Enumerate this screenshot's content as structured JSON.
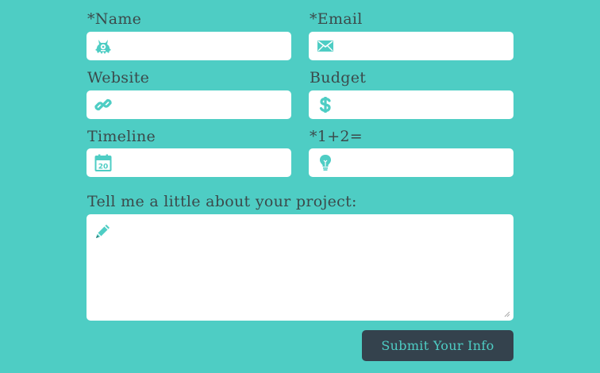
{
  "form": {
    "name_label": "*Name",
    "email_label": "*Email",
    "website_label": "Website",
    "budget_label": "Budget",
    "timeline_label": "Timeline",
    "captcha_label": "*1+2=",
    "project_label": "Tell me a little about your project:",
    "submit_label": "Submit Your Info",
    "icons": {
      "name": "monster-icon",
      "email": "envelope-icon",
      "website": "link-icon",
      "budget": "dollar-icon",
      "timeline": "calendar-icon",
      "captcha": "lightbulb-icon",
      "project": "pencil-icon"
    },
    "calendar_day": "20"
  },
  "colors": {
    "background": "#4ecdc4",
    "field": "#ffffff",
    "icon": "#4ecdc4",
    "label_text": "#3b4a4b",
    "button": "#34424d",
    "button_text": "#4ecdc4"
  }
}
